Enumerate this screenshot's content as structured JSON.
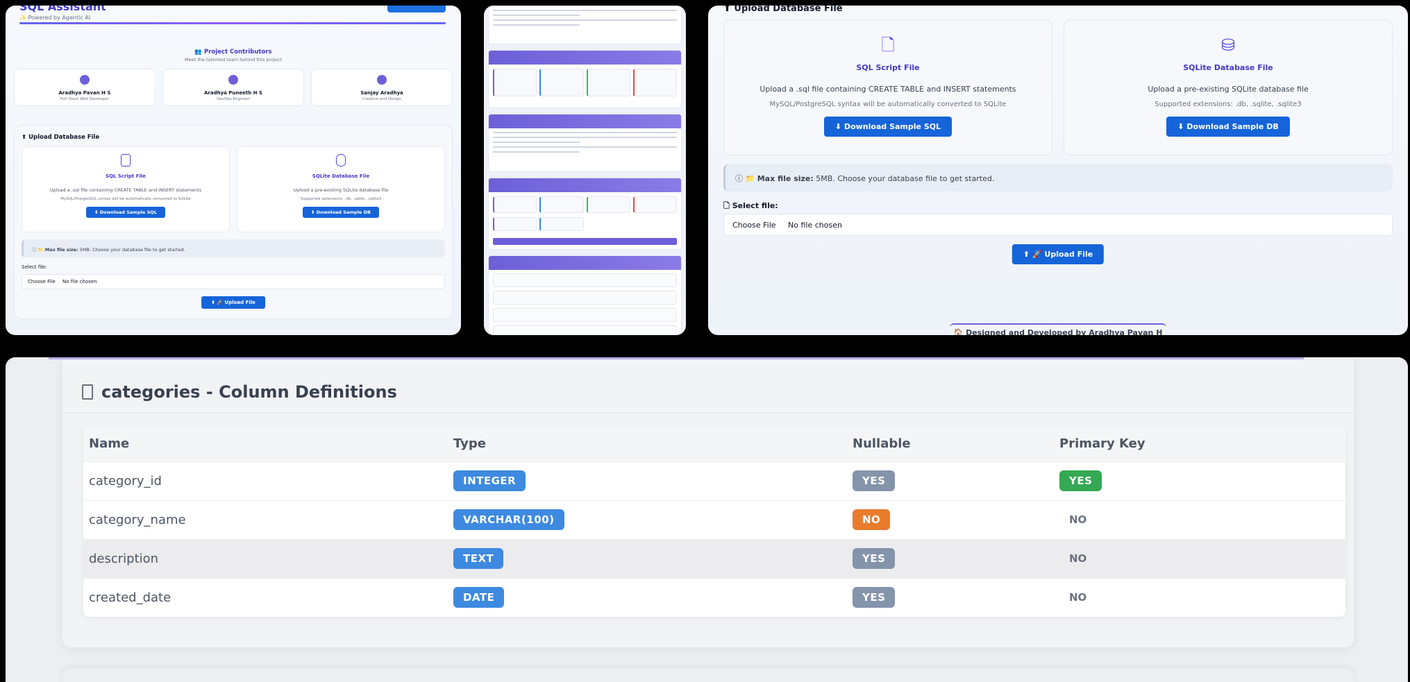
{
  "app": {
    "title": "SQL Assistant",
    "subtitle": "✨ Powered by Agentic AI"
  },
  "contributors": {
    "title": "👥 Project Contributors",
    "subtitle": "Meet the talented team behind this project",
    "people": [
      {
        "name": "Aradhya Pavan H S",
        "role": "Full Stack Web Developer"
      },
      {
        "name": "Aradhya Puneeth H S",
        "role": "DevOps Engineer"
      },
      {
        "name": "Sanjay Aradhya",
        "role": "Creative and Design"
      }
    ]
  },
  "upload": {
    "title": "Upload Database File",
    "sql_card": {
      "icon": "sql-file-icon",
      "icon_label": "SQL",
      "title": "SQL Script File",
      "description": "Upload a .sql file containing CREATE TABLE and INSERT statements",
      "note": "MySQL/PostgreSQL syntax will be automatically converted to SQLite",
      "button": "⬇ Download Sample SQL"
    },
    "db_card": {
      "icon": "database-icon",
      "title": "SQLite Database File",
      "description": "Upload a pre-existing SQLite database file",
      "note": "Supported extensions: .db, .sqlite, .sqlite3",
      "button": "⬇ Download Sample DB"
    },
    "info": {
      "icon": "ⓘ 📁",
      "strong": "Max file size:",
      "text": " 5MB. Choose your database file to get started."
    },
    "select_label": "Select file:",
    "choose_button": "Choose File",
    "no_file": "No file chosen",
    "upload_button": "⬆ 🚀 Upload File"
  },
  "footer": {
    "text": "🏠 Designed and Developed by Aradhya Pavan H S ✨"
  },
  "columns": {
    "title": "categories - Column Definitions",
    "headers": [
      "Name",
      "Type",
      "Nullable",
      "Primary Key"
    ],
    "rows": [
      {
        "name": "category_id",
        "type": "INTEGER",
        "nullable": "YES",
        "pk": "YES"
      },
      {
        "name": "category_name",
        "type": "VARCHAR(100)",
        "nullable": "NO",
        "pk": "NO"
      },
      {
        "name": "description",
        "type": "TEXT",
        "nullable": "YES",
        "pk": "NO"
      },
      {
        "name": "created_date",
        "type": "DATE",
        "nullable": "YES",
        "pk": "NO"
      }
    ]
  },
  "colors": {
    "accent": "#4338ca",
    "button": "#1664d9",
    "type_badge": "#3d8ae0",
    "yes_badge": "#8494ab",
    "no_badge": "#e87b2c",
    "pk_badge": "#34a853"
  }
}
